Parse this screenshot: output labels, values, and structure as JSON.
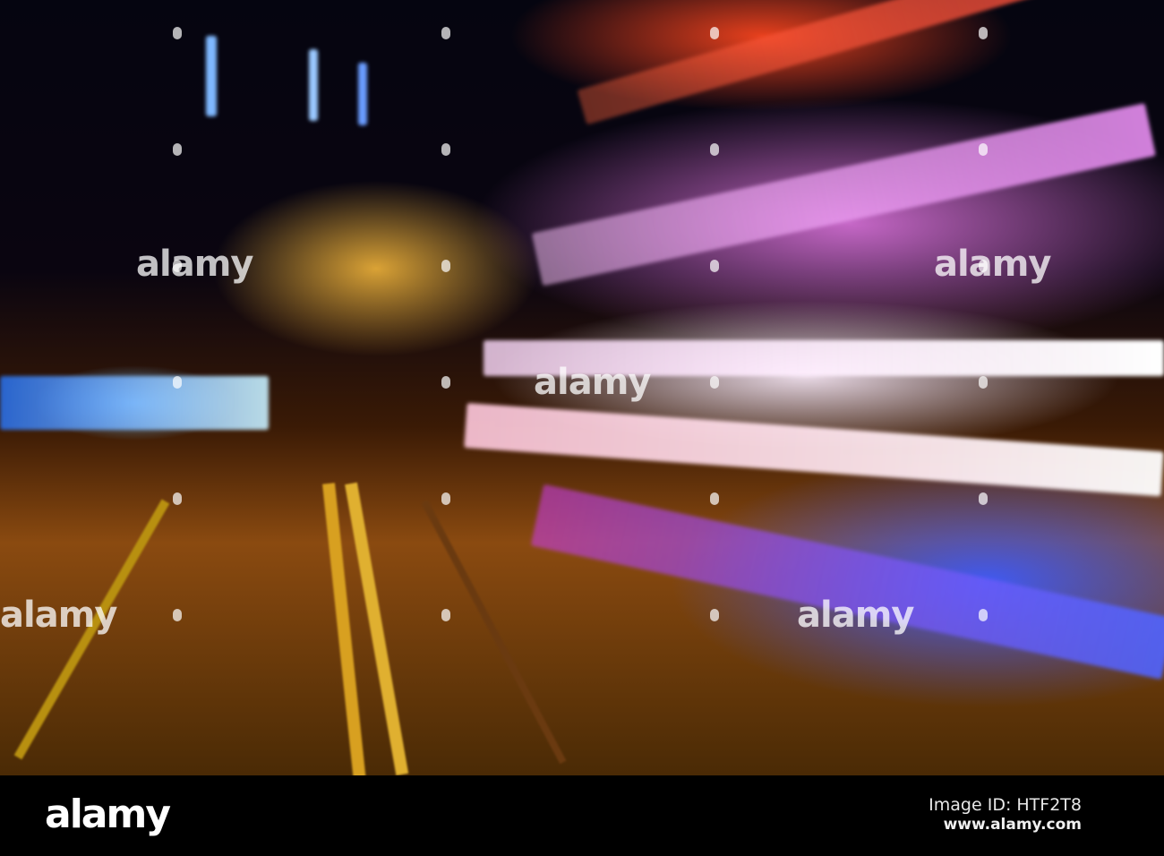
{
  "photo": {
    "description_colors": {
      "orange": "#ff9a30",
      "magenta": "#e070e0",
      "blue": "#3040ff"
    },
    "watermark_text": "alamy"
  },
  "footer": {
    "logo": "alamy",
    "image_id": "Image ID: HTF2T8",
    "url": "www.alamy.com"
  }
}
